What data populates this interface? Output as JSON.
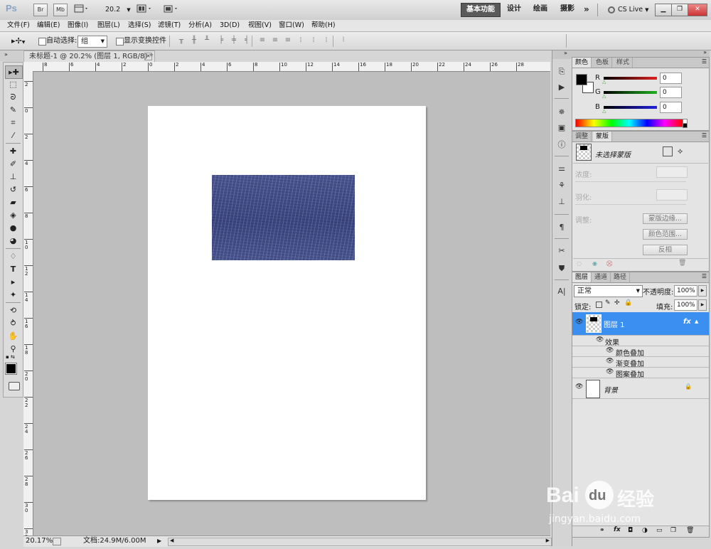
{
  "app": {
    "logo": "Ps",
    "bridge": "Br",
    "minibridge": "Mb",
    "zoom_select": "20.2",
    "workspaces": [
      "基本功能",
      "设计",
      "绘画",
      "摄影"
    ],
    "more": "»",
    "cslive": "CS Live"
  },
  "menu": [
    "文件(F)",
    "编辑(E)",
    "图像(I)",
    "图层(L)",
    "选择(S)",
    "滤镜(T)",
    "分析(A)",
    "3D(D)",
    "视图(V)",
    "窗口(W)",
    "帮助(H)"
  ],
  "options": {
    "auto_select_label": "自动选择:",
    "auto_select_value": "组",
    "show_transform_label": "显示变换控件"
  },
  "document": {
    "tab_title": "未标题-1 @ 20.2% (图层 1, RGB/8) *",
    "zoom": "20.17%",
    "doc_info": "文档:24.9M/6.00M",
    "h_ruler": [
      "8",
      "6",
      "4",
      "2",
      "0",
      "2",
      "4",
      "6",
      "8",
      "10",
      "12",
      "14",
      "16",
      "18",
      "20",
      "22",
      "24",
      "26",
      "28"
    ],
    "v_ruler": [
      "2",
      "0",
      "2",
      "4",
      "6",
      "8",
      "1\n0",
      "1\n2",
      "1\n4",
      "1\n6",
      "1\n8",
      "2\n0",
      "2\n2",
      "2\n4",
      "2\n6",
      "2\n8",
      "3\n0",
      "3\n2"
    ]
  },
  "color_panel": {
    "tabs": [
      "颜色",
      "色板",
      "样式"
    ],
    "channels": [
      {
        "label": "R",
        "value": "0",
        "color": "#e02020"
      },
      {
        "label": "G",
        "value": "0",
        "color": "#20b020"
      },
      {
        "label": "B",
        "value": "0",
        "color": "#2020e0"
      }
    ]
  },
  "masks_panel": {
    "tabs": [
      "调整",
      "蒙版"
    ],
    "no_mask": "未选择蒙版",
    "density_label": "浓度:",
    "feather_label": "羽化:",
    "refine_label": "调整:",
    "buttons": [
      "蒙版边缘...",
      "颜色范围...",
      "反相"
    ]
  },
  "layers_panel": {
    "tabs": [
      "图层",
      "通道",
      "路径"
    ],
    "blend_mode": "正常",
    "opacity_label": "不透明度:",
    "opacity": "100%",
    "lock_label": "锁定:",
    "fill_label": "填充:",
    "fill": "100%",
    "layers": [
      {
        "name": "图层 1",
        "fx": "fx",
        "effects_label": "效果",
        "effects": [
          "颜色叠加",
          "渐变叠加",
          "图案叠加"
        ]
      },
      {
        "name": "背景"
      }
    ]
  },
  "watermark": {
    "brand": "Bai",
    "paw": "du",
    "text": "经验",
    "url": "jingyan.baidu.com"
  }
}
